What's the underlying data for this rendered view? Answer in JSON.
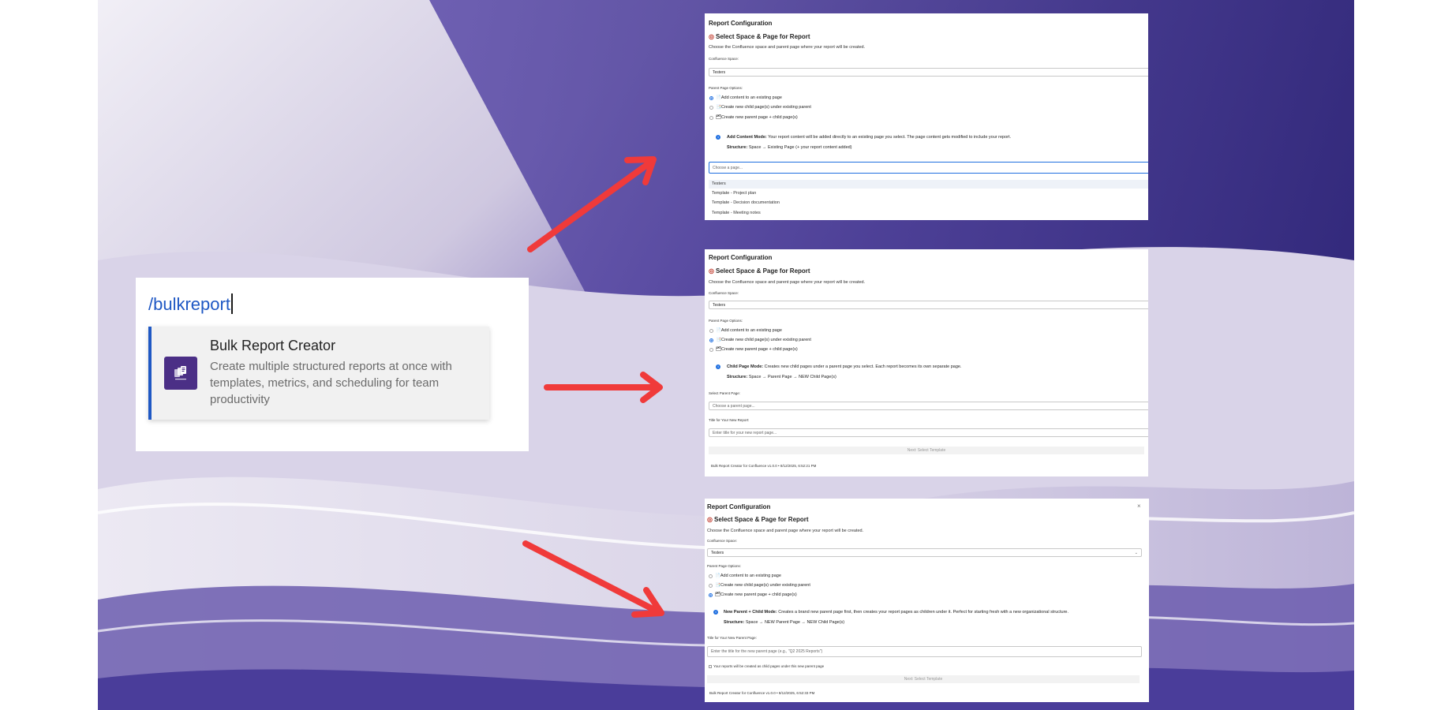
{
  "colors": {
    "accent": "#1f58c4",
    "radio_active": "#1f6fe0",
    "arrow": "#f03a3a",
    "app_icon_bg": "#4b2f86",
    "wallpaper_dark": "#3a2f86",
    "wallpaper_light": "#e9e6f2"
  },
  "command": {
    "typed_text": "/bulkreport",
    "suggestion": {
      "icon": "bulk-report-app-icon",
      "title": "Bulk Report Creator",
      "description": "Create multiple structured reports at once with templates, metrics, and scheduling for team productivity"
    }
  },
  "panels": {
    "add_content": {
      "title": "Report Configuration",
      "subtitle": "Select Space & Page for Report",
      "description": "Choose the Confluence space and parent page where your report will be created.",
      "space_label": "Confluence Space:",
      "space_value": "Testers",
      "options_label": "Parent Page Options:",
      "options": [
        "Add content to an existing page",
        "Create new child page(s) under existing parent",
        "Create new parent page + child page(s)"
      ],
      "selected_option": 0,
      "mode_label": "Add Content Mode:",
      "mode_text": "Your report content will be added directly to an existing page you select. The page content gets modified to include your report.",
      "structure_label": "Structure:",
      "structure_text": "Space → Existing Page (+ your report content added)",
      "page_placeholder": "Choose a page...",
      "dropdown_items": [
        "Testers",
        "Template - Project plan",
        "Template - Decision documentation",
        "Template - Meeting notes"
      ]
    },
    "child_page": {
      "title": "Report Configuration",
      "subtitle": "Select Space & Page for Report",
      "description": "Choose the Confluence space and parent page where your report will be created.",
      "space_label": "Confluence Space:",
      "space_value": "Testers",
      "options_label": "Parent Page Options:",
      "options": [
        "Add content to an existing page",
        "Create new child page(s) under existing parent",
        "Create new parent page + child page(s)"
      ],
      "selected_option": 1,
      "mode_label": "Child Page Mode:",
      "mode_text": "Creates new child pages under a parent page you select. Each report becomes its own separate page.",
      "structure_label": "Structure:",
      "structure_text": "Space → Parent Page → NEW Child Page(s)",
      "parent_label": "Select Parent Page:",
      "parent_placeholder": "Choose a parent page...",
      "title_label": "Title for Your New Report:",
      "title_placeholder": "Enter title for your new report page...",
      "next_button": "Next: Select Template",
      "footer": "Bulk Report Creator for Confluence v1.0.0 • 8/12/2025, 6:52:21 PM"
    },
    "new_parent": {
      "title": "Report Configuration",
      "close": "×",
      "subtitle": "Select Space & Page for Report",
      "description": "Choose the Confluence space and parent page where your report will be created.",
      "space_label": "Confluence Space:",
      "space_value": "Testers",
      "options_label": "Parent Page Options:",
      "options": [
        "Add content to an existing page",
        "Create new child page(s) under existing parent",
        "Create new parent page + child page(s)"
      ],
      "selected_option": 2,
      "mode_label": "New Parent + Child Mode:",
      "mode_text": "Creates a brand new parent page first, then creates your report pages as children under it. Perfect for starting fresh with a new organizational structure.",
      "structure_label": "Structure:",
      "structure_text": "Space → NEW Parent Page → NEW Child Page(s)",
      "parent_title_label": "Title for Your New Parent Page:",
      "parent_title_placeholder": "Enter the title for the new parent page (e.g., \"Q2 2025 Reports\")",
      "note": "Your reports will be created as child pages under this new parent page",
      "next_button": "Next: Select Template",
      "footer": "Bulk Report Creator for Confluence v1.0.0 • 8/12/2025, 6:52:33 PM"
    }
  }
}
